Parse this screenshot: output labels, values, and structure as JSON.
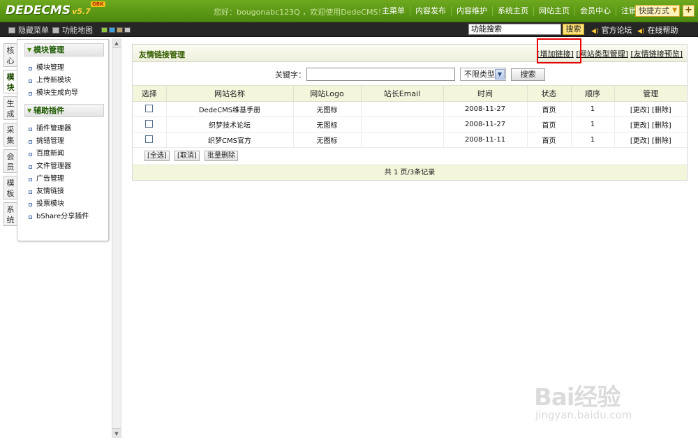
{
  "header": {
    "brand": "DEDECMS",
    "version": "v5.7",
    "flag": "GBK",
    "welcome": "您好：bougonabc123Q ，欢迎使用DedeCMS！",
    "nav": [
      "主菜单",
      "内容发布",
      "内容维护",
      "系统主页",
      "网站主页",
      "会员中心",
      "注销"
    ],
    "shortcut_label": "快捷方式",
    "plus_label": "+"
  },
  "subbar": {
    "hide_menu": "隐藏菜单",
    "function_map": "功能地图",
    "color_swatches": [
      "#8fc73e",
      "#3ea3e3",
      "#b9a06b",
      "#c6c6c6"
    ],
    "search_value": "功能搜索",
    "search_button": "搜索",
    "forum_link": "官方论坛",
    "help_link": "在线帮助"
  },
  "side_tabs": [
    {
      "label": "核心",
      "active": false
    },
    {
      "label": "模块",
      "active": true
    },
    {
      "label": "生成",
      "active": false
    },
    {
      "label": "采集",
      "active": false
    },
    {
      "label": "会员",
      "active": false
    },
    {
      "label": "模板",
      "active": false
    },
    {
      "label": "系统",
      "active": false
    }
  ],
  "menu": {
    "groups": [
      {
        "title": "模块管理",
        "items": [
          "模块管理",
          "上传新模块",
          "模块生成向导"
        ]
      },
      {
        "title": "辅助插件",
        "items": [
          "插件管理器",
          "挑错管理",
          "百度新闻",
          "文件管理器",
          "广告管理",
          "友情链接",
          "投票模块",
          "bShare分享插件"
        ]
      }
    ]
  },
  "panel": {
    "title": "友情链接管理",
    "links": [
      "[增加链接]",
      "[网站类型管理]",
      "[友情链接预览]"
    ],
    "keyword_label": "关键字：",
    "keyword_value": "",
    "type_select": "不限类型",
    "search_button": "搜索",
    "columns": [
      "选择",
      "网站名称",
      "网站Logo",
      "站长Email",
      "时间",
      "状态",
      "顺序",
      "管理"
    ],
    "rows": [
      {
        "name": "DedeCMS维基手册",
        "logo": "无图标",
        "email": "",
        "time": "2008-11-27",
        "status": "首页",
        "order": "1",
        "manage": "[更改] [删除]"
      },
      {
        "name": "织梦技术论坛",
        "logo": "无图标",
        "email": "",
        "time": "2008-11-27",
        "status": "首页",
        "order": "1",
        "manage": "[更改] [删除]"
      },
      {
        "name": "织梦CMS官方",
        "logo": "无图标",
        "email": "",
        "time": "2008-11-11",
        "status": "首页",
        "order": "1",
        "manage": "[更改] [删除]"
      }
    ],
    "actions": [
      "[全选]",
      "[取消]",
      "批量删除"
    ],
    "footer": "共 1 页/3条记录"
  },
  "watermark": {
    "text": "Bai经验",
    "sub": "jingyan.baidu.com"
  }
}
